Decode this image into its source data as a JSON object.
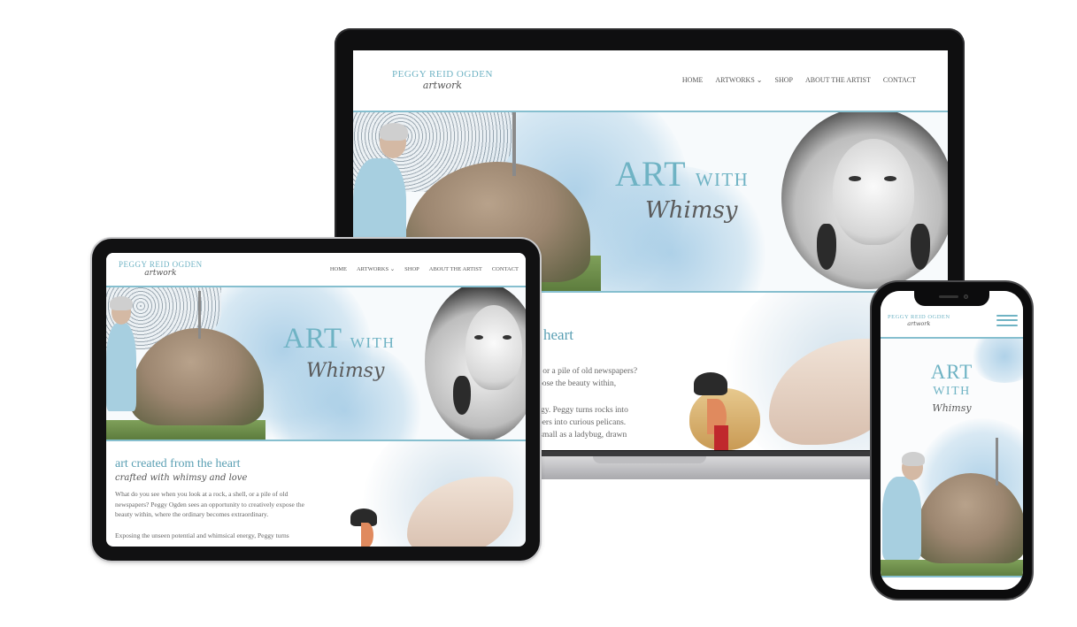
{
  "site": {
    "logo_name": "PEGGY REID OGDEN",
    "logo_sub": "artwork",
    "nav": [
      "HOME",
      "ARTWORKS ⌄",
      "SHOP",
      "ABOUT THE ARTIST",
      "CONTACT"
    ],
    "hero_art": "ART",
    "hero_with": "WITH",
    "hero_whimsy": "Whimsy",
    "heading": "art created from the heart",
    "heading_fragment": "heart",
    "tagline": "crafted with whimsy and love",
    "para1": "What do you see when you look at a rock, a shell, or a pile of old newspapers? Peggy Ogden sees an opportunity to creatively expose the beauty within, where the ordinary becomes extraordinary.",
    "para2_start": "Exposing the unseen potential and whimsical energy, Peggy turns",
    "laptop_lines": [
      "ell, or a pile of old newspapers?",
      "expose the beauty within,",
      "nergy. Peggy turns rocks into",
      "papers into curious pelicans.",
      "as small as a ladybug, drawn"
    ]
  },
  "colors": {
    "accent": "#6fb3c4",
    "rule": "#86bfcf",
    "text": "#666666"
  }
}
